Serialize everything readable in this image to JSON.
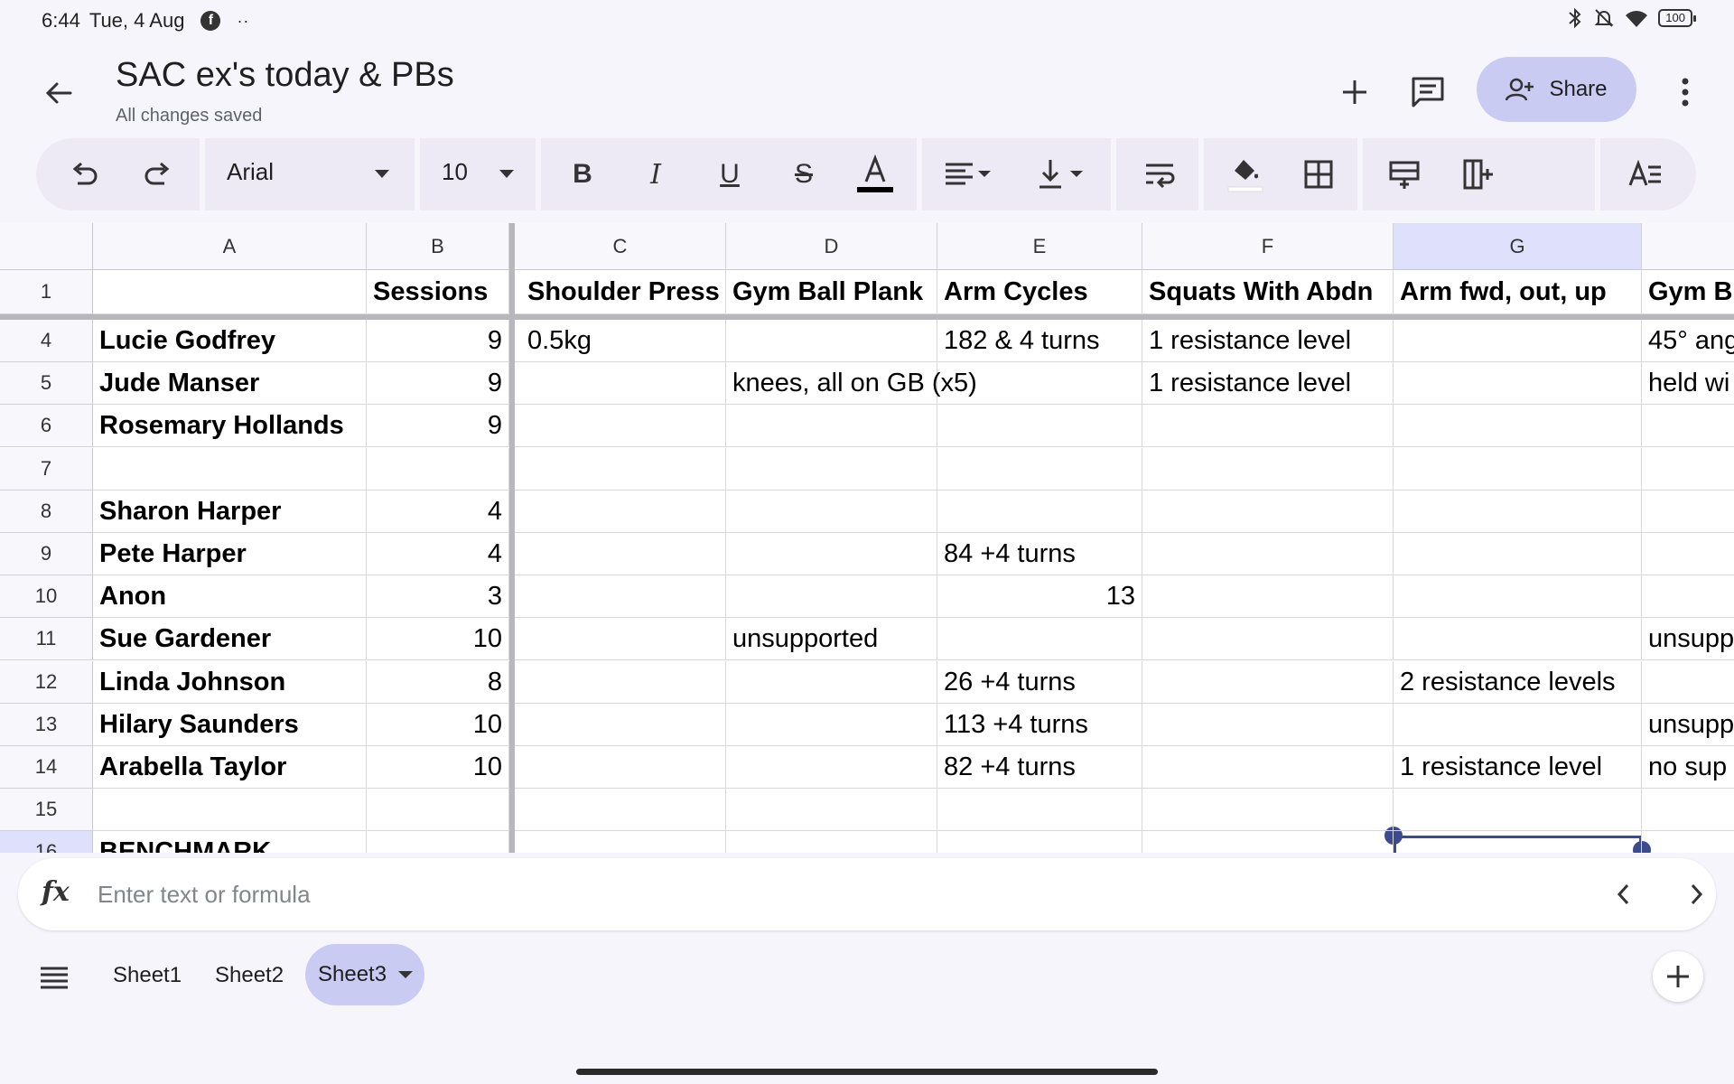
{
  "status_bar": {
    "time": "6:44",
    "date": "Tue, 4 Aug",
    "more": "··",
    "battery": "100"
  },
  "document": {
    "title": "SAC ex's today & PBs",
    "save_status": "All changes saved",
    "share_label": "Share"
  },
  "toolbar": {
    "font": "Arial",
    "font_size": "10",
    "text_color": "#000000",
    "fill_color": "#ffffff"
  },
  "columns": [
    "A",
    "B",
    "C",
    "D",
    "E",
    "F",
    "G",
    ""
  ],
  "selected_column": "G",
  "header_row": {
    "row": "1",
    "cells": [
      "",
      "Sessions",
      "Shoulder Press",
      "Gym Ball Plank",
      "Arm Cycles",
      "Squats With Abdn",
      "Arm fwd, out, up",
      "Gym B"
    ]
  },
  "rows": [
    {
      "row": "4",
      "cells": [
        "Lucie Godfrey",
        "9",
        "0.5kg",
        "",
        "182 & 4 turns",
        "1 resistance level",
        "",
        "45° ang"
      ]
    },
    {
      "row": "5",
      "cells": [
        "Jude Manser",
        "9",
        "",
        "knees, all on GB (x5)",
        "",
        "1 resistance level",
        "",
        "held wi"
      ]
    },
    {
      "row": "6",
      "cells": [
        "Rosemary Hollands",
        "9",
        "",
        "",
        "",
        "",
        "",
        ""
      ]
    },
    {
      "row": "7",
      "cells": [
        "",
        "",
        "",
        "",
        "",
        "",
        "",
        ""
      ]
    },
    {
      "row": "8",
      "cells": [
        "Sharon Harper",
        "4",
        "",
        "",
        "",
        "",
        "",
        ""
      ]
    },
    {
      "row": "9",
      "cells": [
        "Pete Harper",
        "4",
        "",
        "",
        "84 +4 turns",
        "",
        "",
        ""
      ]
    },
    {
      "row": "10",
      "cells": [
        "Anon",
        "3",
        "",
        "",
        "13",
        "",
        "",
        ""
      ]
    },
    {
      "row": "11",
      "cells": [
        "Sue Gardener",
        "10",
        "",
        "unsupported",
        "",
        "",
        "",
        "unsupp"
      ]
    },
    {
      "row": "12",
      "cells": [
        "Linda Johnson",
        "8",
        "",
        "",
        "26 +4 turns",
        "",
        "2 resistance levels",
        ""
      ]
    },
    {
      "row": "13",
      "cells": [
        "Hilary Saunders",
        "10",
        "",
        "",
        "113 +4 turns",
        "",
        "",
        "unsupp"
      ]
    },
    {
      "row": "14",
      "cells": [
        "Arabella Taylor",
        "10",
        "",
        "",
        "82 +4 turns",
        "",
        "1 resistance level",
        "no sup"
      ]
    },
    {
      "row": "15",
      "cells": [
        "",
        "",
        "",
        "",
        "",
        "",
        "",
        ""
      ]
    },
    {
      "row": "16",
      "cells": [
        "BENCHMARK",
        "",
        "",
        "",
        "",
        "",
        "",
        ""
      ]
    }
  ],
  "formula_bar": {
    "placeholder": "Enter text or formula",
    "value": ""
  },
  "sheets": [
    {
      "label": "Sheet1",
      "active": false
    },
    {
      "label": "Sheet2",
      "active": false
    },
    {
      "label": "Sheet3",
      "active": true
    }
  ],
  "colors": {
    "accent": "#c9cbf3",
    "selection": "#3c4b8e",
    "selected_header": "#dfe0fb"
  }
}
